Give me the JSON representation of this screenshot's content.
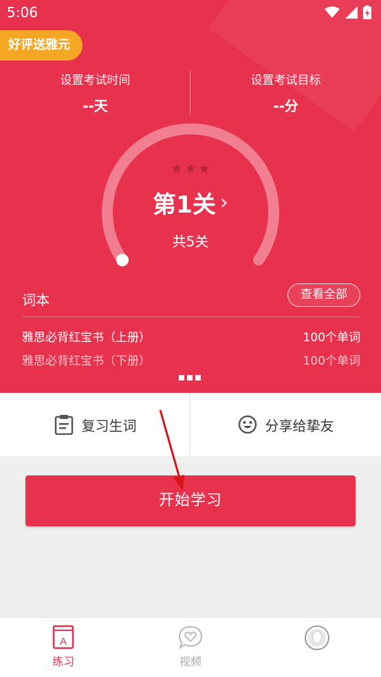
{
  "status": {
    "time": "5:06"
  },
  "promo": {
    "label": "好评送雅元"
  },
  "settings": {
    "exam_time": {
      "label": "设置考试时间",
      "value": "--天"
    },
    "exam_goal": {
      "label": "设置考试目标",
      "value": "--分"
    }
  },
  "level": {
    "stars": 3,
    "title": "第1关",
    "total": "共5关",
    "progress": 0
  },
  "vocab": {
    "title": "词本",
    "view_all": "查看全部",
    "books": [
      {
        "name": "雅思必背红宝书（上册）",
        "count": "100个单词"
      },
      {
        "name": "雅思必背红宝书（下册）",
        "count": "100个单词"
      }
    ]
  },
  "actions": {
    "review": "复习生词",
    "share": "分享给挚友"
  },
  "start": {
    "label": "开始学习"
  },
  "tabs": [
    {
      "label": "练习",
      "icon": "book-icon",
      "active": true
    },
    {
      "label": "视频",
      "icon": "heart-bubble-icon",
      "active": false
    },
    {
      "label": "",
      "icon": "avatar-icon",
      "active": false
    }
  ],
  "colors": {
    "primary": "#e8314d",
    "promo": "#f5a623"
  }
}
